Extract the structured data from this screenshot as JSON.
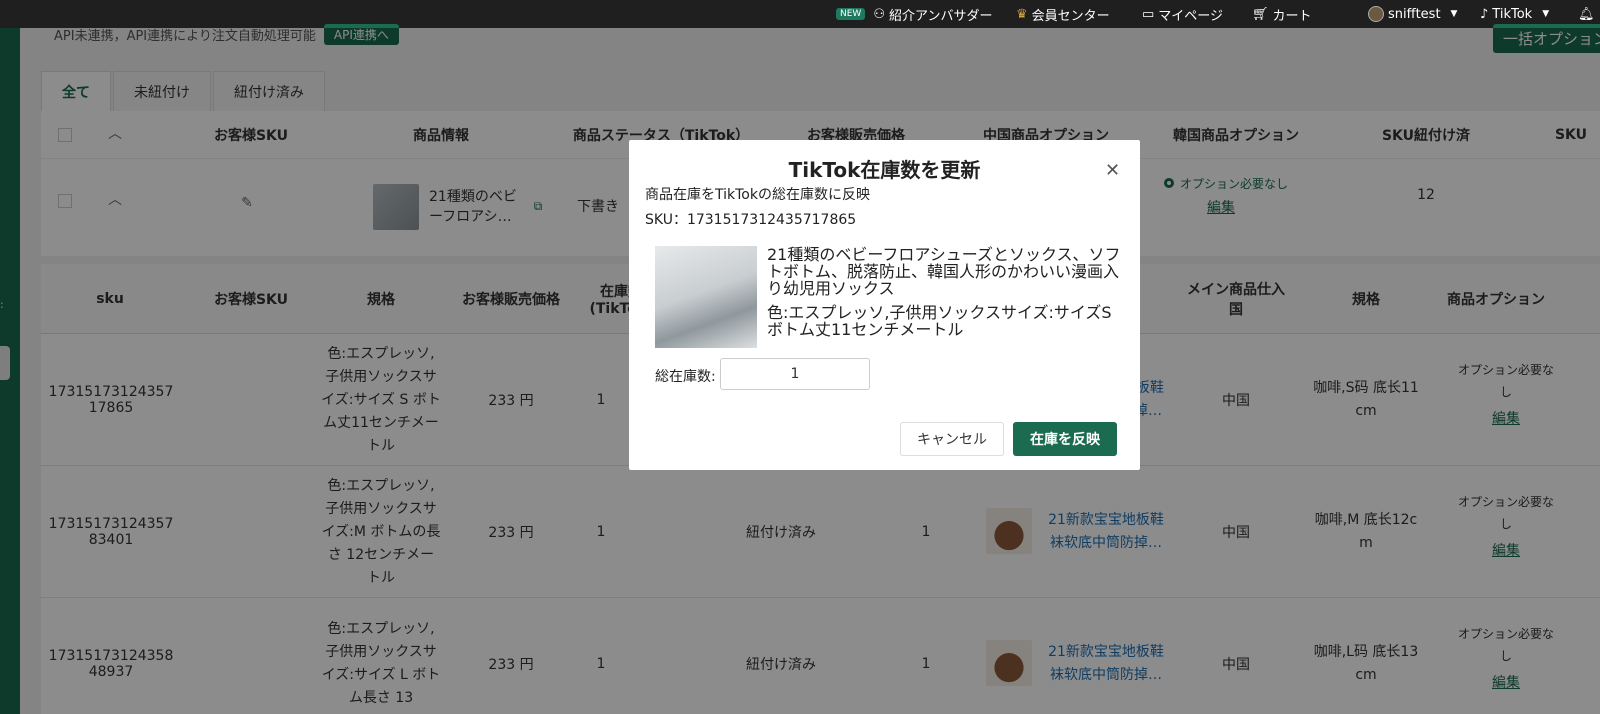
{
  "colors": {
    "brand": "#1a6b50",
    "topbar": "#1f1f1f",
    "link": "#1f6fb2"
  },
  "topbar": {
    "new_badge": "NEW",
    "ambassador": "紹介アンバサダー",
    "member": "会員センター",
    "mypage": "マイページ",
    "cart": "カート",
    "user": "snifftest",
    "platform": "TikTok"
  },
  "page": {
    "api_note": "API未連携，API連携により注文自動処理可能",
    "api_button": "API連携へ",
    "bulk_button": "一括オプション"
  },
  "tabs": [
    "全て",
    "未紐付け",
    "紐付け済み"
  ],
  "product_table": {
    "headers": [
      "お客様SKU",
      "商品情報",
      "商品ステータス（TikTok）",
      "お客様販売価格",
      "中国商品オプション",
      "韓国商品オプション",
      "SKU紐付け済",
      "SKU"
    ],
    "row": {
      "name": "21種類のベビーフロアシ…",
      "status": "下書き",
      "korea_option": "オプション必要なし",
      "edit": "編集",
      "sku_count": "12"
    }
  },
  "sku_table": {
    "headers": [
      "sku",
      "お客様SKU",
      "規格",
      "お客様販売価格",
      "在庫数(TikTok)",
      "メイン商品仕入国",
      "規格",
      "商品オプション"
    ],
    "rows": [
      {
        "sku": "17315173124357 17865",
        "spec": "色:エスプレッソ,子供用ソックスサイズ:サイズ S ボトム丈11センチメートル",
        "price": "233 円",
        "stock": "1",
        "status": "",
        "qty": "",
        "cn_name": "21新款宝宝地板鞋 袜软底中筒防掉…",
        "country": "中国",
        "cn_spec": "咖啡,S码 底长11 cm",
        "option": "オプション必要なし",
        "edit": "編集"
      },
      {
        "sku": "17315173124357 83401",
        "spec": "色:エスプレッソ,子供用ソックスサイズ:M ボトムの長さ 12センチメートル",
        "price": "233 円",
        "stock": "1",
        "status": "紐付け済み",
        "qty": "1",
        "cn_name": "21新款宝宝地板鞋 袜软底中筒防掉…",
        "country": "中国",
        "cn_spec": "咖啡,M 底长12c m",
        "option": "オプション必要なし",
        "edit": "編集"
      },
      {
        "sku": "17315173124358 48937",
        "spec": "色:エスプレッソ,子供用ソックスサイズ:サイズ L ボトム長さ 13",
        "price": "233 円",
        "stock": "1",
        "status": "紐付け済み",
        "qty": "1",
        "cn_name": "21新款宝宝地板鞋 袜软底中筒防掉…",
        "country": "中国",
        "cn_spec": "咖啡,L码 底长13 cm",
        "option": "オプション必要なし",
        "edit": "編集"
      }
    ]
  },
  "modal": {
    "title": "TikTok在庫数を更新",
    "subtitle": "商品在庫をTikTokの総在庫数に反映",
    "sku": "SKU：1731517312435717865",
    "product_name": "21種類のベビーフロアシューズとソックス、ソフトボトム、脱落防止、韓国人形のかわいい漫画入り幼児用ソックス",
    "variant": "色:エスプレッソ,子供用ソックスサイズ:サイズS ボトム丈11センチメートル",
    "stock_label": "総在庫数:",
    "stock_value": "1",
    "cancel": "キャンセル",
    "apply": "在庫を反映"
  }
}
